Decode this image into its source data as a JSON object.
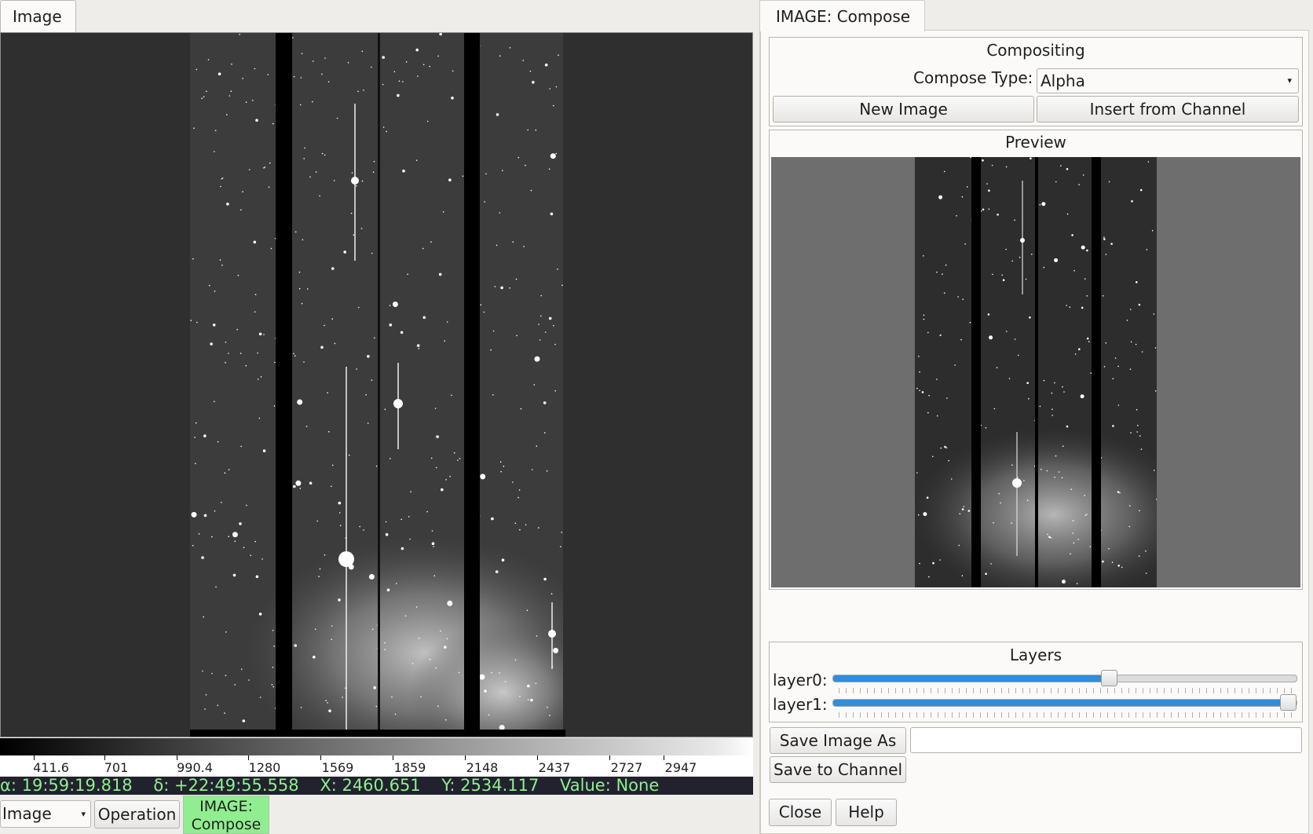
{
  "left_tab": {
    "label": "Image"
  },
  "colorbar": {
    "ticks": [
      "411.6",
      "701",
      "990.4",
      "1280",
      "1569",
      "1859",
      "2148",
      "2437",
      "2727",
      "2947"
    ]
  },
  "status": {
    "ra": "α: 19:59:19.818",
    "dec": "δ: +22:49:55.558",
    "x": "X: 2460.651",
    "y": "Y: 2534.117",
    "value": "Value: None"
  },
  "bottom_bar": {
    "channel_select": "Image",
    "operation_button": "Operation",
    "active_plugin_line1": "IMAGE:",
    "active_plugin_line2": "Compose"
  },
  "right_tab": {
    "label": "IMAGE: Compose"
  },
  "compositing": {
    "title": "Compositing",
    "compose_type_label": "Compose Type:",
    "compose_type_value": "Alpha",
    "new_image_button": "New Image",
    "insert_button": "Insert from Channel"
  },
  "preview": {
    "title": "Preview"
  },
  "layers": {
    "title": "Layers",
    "items": [
      {
        "label": "layer0:",
        "level": 0.59
      },
      {
        "label": "layer1:",
        "level": 1.0
      }
    ]
  },
  "save": {
    "save_as_button": "Save Image As",
    "save_as_value": "",
    "save_channel_button": "Save to Channel"
  },
  "footer": {
    "close_button": "Close",
    "help_button": "Help"
  },
  "colors": {
    "accent": "#2d8ede",
    "status_text": "#8ff08f",
    "active_tab": "#90ee90"
  }
}
